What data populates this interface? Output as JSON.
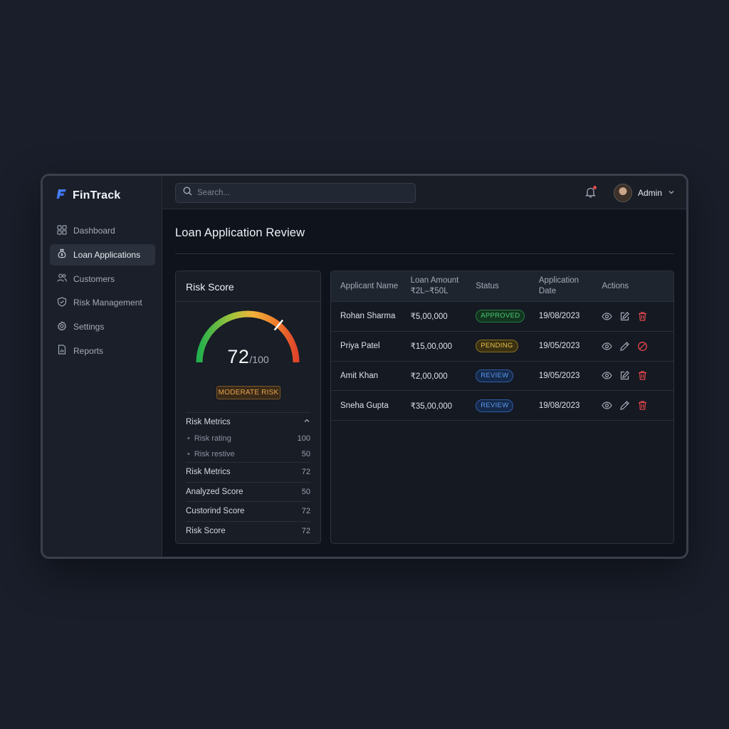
{
  "brand": {
    "name": "FinTrack"
  },
  "sidebar": {
    "items": [
      {
        "label": "Dashboard",
        "icon": "grid-icon",
        "active": false
      },
      {
        "label": "Loan Applications",
        "icon": "money-bag-icon",
        "active": true
      },
      {
        "label": "Customers",
        "icon": "users-icon",
        "active": false
      },
      {
        "label": "Risk Management",
        "icon": "shield-icon",
        "active": false
      },
      {
        "label": "Settings",
        "icon": "gear-icon",
        "active": false
      },
      {
        "label": "Reports",
        "icon": "report-icon",
        "active": false
      }
    ]
  },
  "topbar": {
    "search_placeholder": "Search...",
    "user_name": "Admin"
  },
  "page": {
    "title": "Loan Application Review"
  },
  "risk": {
    "title": "Risk Score",
    "score": "72",
    "max": "/100",
    "score_fraction": 0.72,
    "badge": "MODERATE RISK",
    "metrics_header": "Risk Metrics",
    "sub_items": [
      {
        "label": "Risk rating",
        "value": "100"
      },
      {
        "label": "Risk restive",
        "value": "50"
      }
    ],
    "rows": [
      {
        "label": "Risk Metrics",
        "value": "72"
      },
      {
        "label": "Analyzed Score",
        "value": "50"
      },
      {
        "label": "Custorind Score",
        "value": "72"
      },
      {
        "label": "Risk Score",
        "value": "72"
      }
    ]
  },
  "table": {
    "headers": {
      "name": "Applicant Name",
      "amount_line1": "Loan Amount",
      "amount_line2": "₹2L–₹50L",
      "status": "Status",
      "date_line1": "Application",
      "date_line2": "Date",
      "actions": "Actions"
    },
    "rows": [
      {
        "name": "Rohan Sharma",
        "amount": "₹5,00,000",
        "status": "APPROVED",
        "date": "19/08/2023"
      },
      {
        "name": "Priya Patel",
        "amount": "₹15,00,000",
        "status": "PENDING",
        "date": "19/05/2023"
      },
      {
        "name": "Amit Khan",
        "amount": "₹2,00,000",
        "status": "REVIEW",
        "date": "19/05/2023"
      },
      {
        "name": "Sneha Gupta",
        "amount": "₹35,00,000",
        "status": "REVIEW",
        "date": "19/08/2023"
      }
    ]
  },
  "colors": {
    "accent_blue": "#3b82f6",
    "approved": "#4ccb73",
    "pending": "#e8c14a",
    "review": "#5b9cf0",
    "danger": "#e5484d",
    "moderate_risk": "#e9a44c"
  }
}
